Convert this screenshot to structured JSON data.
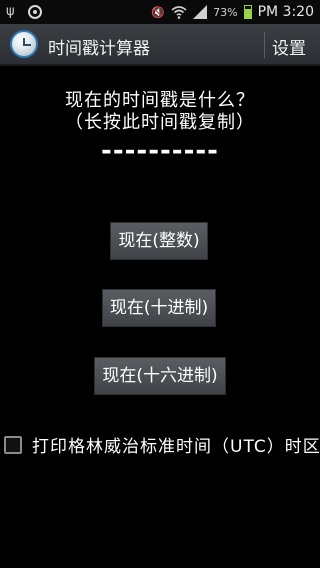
{
  "status_bar": {
    "battery": "73%",
    "time": "PM 3:20",
    "icons": [
      "usb-icon",
      "app-notification-icon",
      "mute-icon",
      "wifi-icon",
      "signal-icon",
      "battery-icon"
    ]
  },
  "action_bar": {
    "title": "时间戳计算器",
    "settings_label": "设置",
    "icon": "clock-icon"
  },
  "main": {
    "question": "现在的时间戳是什么？",
    "hint": "（长按此时间戳复制）",
    "timestamp": "----------",
    "buttons": {
      "now_integer": "现在(整数)",
      "now_decimal": "现在(十进制)",
      "now_hex": "现在(十六进制)"
    },
    "greenwich_option": {
      "label": "打印格林威治标准时间（UTC）时区",
      "checked": false
    }
  },
  "colors": {
    "background": "#000000",
    "action_bar": "#34383c",
    "button": "#4c4f53",
    "text": "#ffffff"
  }
}
